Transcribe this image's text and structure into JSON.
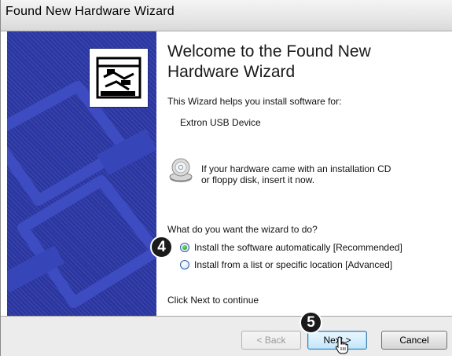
{
  "window": {
    "title": "Found New Hardware Wizard"
  },
  "content": {
    "heading": "Welcome to the Found New Hardware Wizard",
    "intro": "This Wizard helps you install software for:",
    "device_name": "Extron USB Device",
    "cd_prompt_line1": "If your hardware came with an installation CD",
    "cd_prompt_line2": "or floppy disk, insert it now.",
    "question": "What do you want the wizard to do?",
    "options": [
      {
        "label": "Install the software automatically [Recommended]",
        "selected": true
      },
      {
        "label": "Install from a list or specific location [Advanced]",
        "selected": false
      }
    ],
    "continue_hint": "Click Next to continue"
  },
  "buttons": {
    "back": "< Back",
    "next": "Next >",
    "cancel": "Cancel"
  },
  "callouts": {
    "step_4": "4",
    "step_5": "5"
  },
  "icons": {
    "hardware": "hardware-card-icon",
    "cd": "cd-disk-icon",
    "cursor": "hand-pointer-icon"
  },
  "colors": {
    "sidebar": "#2b37a3",
    "radio_selected": "#1f9a27",
    "footer": "#ececec"
  }
}
